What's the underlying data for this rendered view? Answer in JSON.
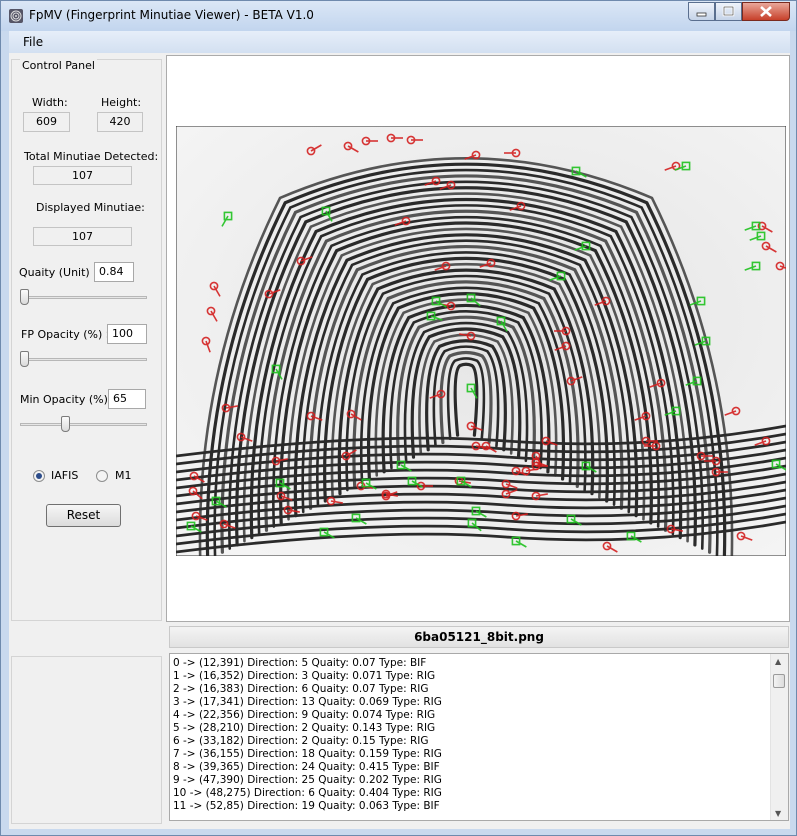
{
  "window": {
    "title": "FpMV (Fingerprint Minutiae Viewer) - BETA V1.0",
    "menu": [
      "File"
    ]
  },
  "control_panel": {
    "title": "Control Panel",
    "width_label": "Width:",
    "width_value": "609",
    "height_label": "Height:",
    "height_value": "420",
    "total_label": "Total Minutiae Detected:",
    "total_value": "107",
    "displayed_label": "Displayed Minutiae:",
    "displayed_value": "107",
    "quality_label": "Quaity (Unit) >",
    "quality_value": "0.84",
    "fp_opacity_label": "FP Opacity (%)  >",
    "fp_opacity_value": "100",
    "min_opacity_label": "Min Opacity (%) >",
    "min_opacity_value": "65",
    "radio_iafis": "IAFIS",
    "radio_m1": "M1",
    "selected_mode": "IAFIS",
    "reset_label": "Reset",
    "quality_slider": 0.0,
    "fp_opacity_slider": 0.0,
    "min_opacity_slider": 0.35
  },
  "colors": {
    "bifurcation": "#d42020",
    "ridge_ending": "#1fc21f"
  },
  "image": {
    "filename": "6ba05121_8bit.png"
  },
  "minutiae_list": [
    "0 -> (12,391)  Direction: 5  Quaity: 0.07  Type: BIF",
    "1 -> (16,352)  Direction: 3  Quaity: 0.071  Type: RIG",
    "2 -> (16,383)  Direction: 6  Quaity: 0.07  Type: RIG",
    "3 -> (17,341)  Direction: 13  Quaity: 0.069  Type: RIG",
    "4 -> (22,356)  Direction: 9  Quaity: 0.074  Type: RIG",
    "5 -> (28,210)  Direction: 2  Quaity: 0.143  Type: RIG",
    "6 -> (33,182)  Direction: 2  Quaity: 0.15  Type: RIG",
    "7 -> (36,155)  Direction: 18  Quaity: 0.159  Type: RIG",
    "8 -> (39,365)  Direction: 24  Quaity: 0.415  Type: BIF",
    "9 -> (47,390)  Direction: 25  Quaity: 0.202  Type: RIG",
    "10 -> (48,275)  Direction: 6  Quaity: 0.404  Type: RIG",
    "11 -> (52,85)  Direction: 19  Quaity: 0.063  Type: BIF"
  ]
}
